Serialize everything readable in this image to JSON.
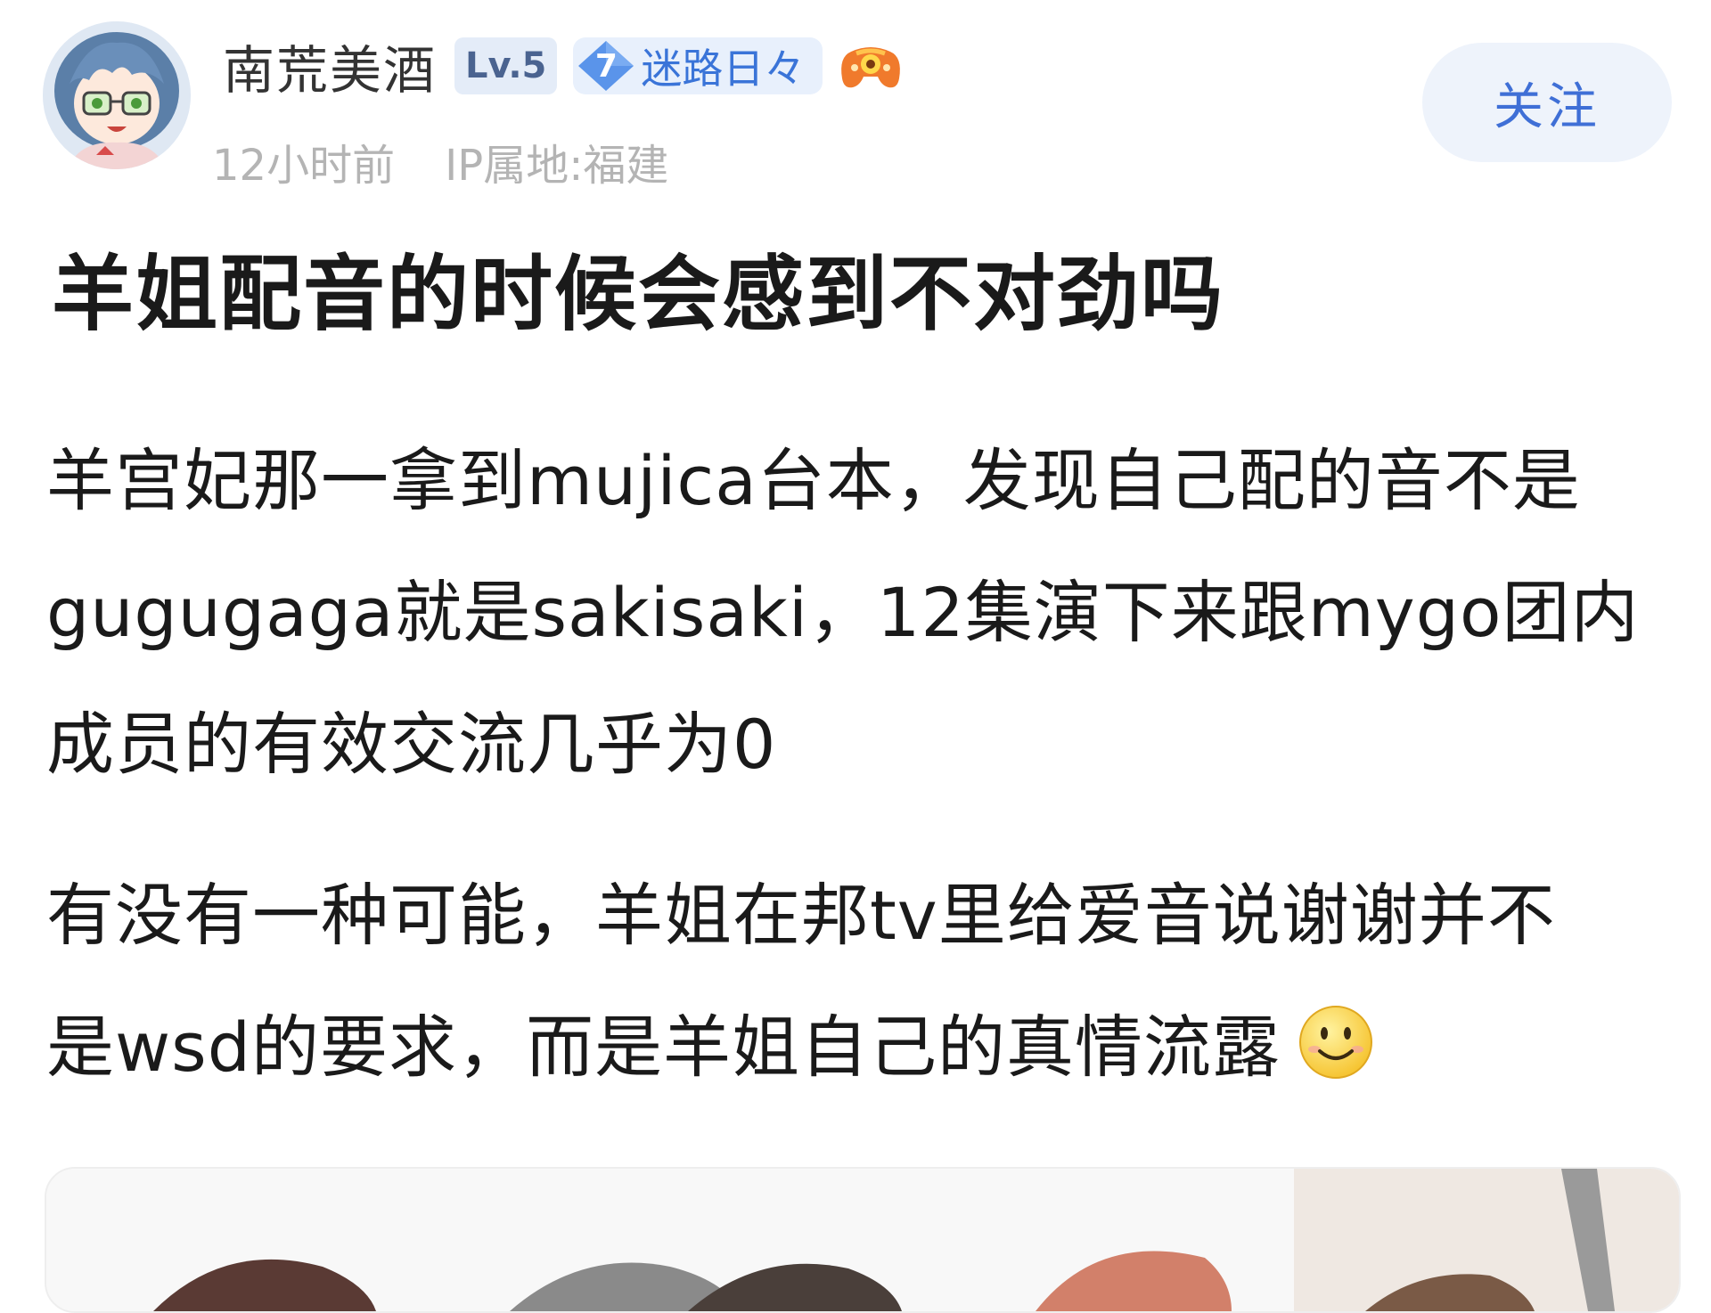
{
  "author": {
    "name": "南荒美酒",
    "level_badge": "Lv.5",
    "fan_medal_level": "7",
    "fan_medal_name": "迷路日々",
    "avatar_icon": "anime-girl-avatar",
    "game_icon": "gamepad-icon"
  },
  "meta": {
    "time": "12小时前",
    "ip_location": "IP属地:福建"
  },
  "actions": {
    "follow_label": "关注"
  },
  "post": {
    "title": "羊姐配音的时候会感到不对劲吗",
    "paragraph_1": {
      "line_1": "羊宫妃那一拿到mujica台本，发现自己配的音不是",
      "line_2": "gugugaga就是sakisaki，12集演下来跟mygo团内",
      "line_3": "成员的有效交流几乎为0"
    },
    "paragraph_2": {
      "line_1": "有没有一种可能，羊姐在邦tv里给爱音说谢谢并不",
      "line_2": "是wsd的要求，而是羊姐自己的真情流露"
    },
    "emoji": "smile-emoji"
  },
  "colors": {
    "accent_blue": "#3f6fd6",
    "follow_bg": "#eef3fb",
    "meta_gray": "#b4b4b4"
  }
}
